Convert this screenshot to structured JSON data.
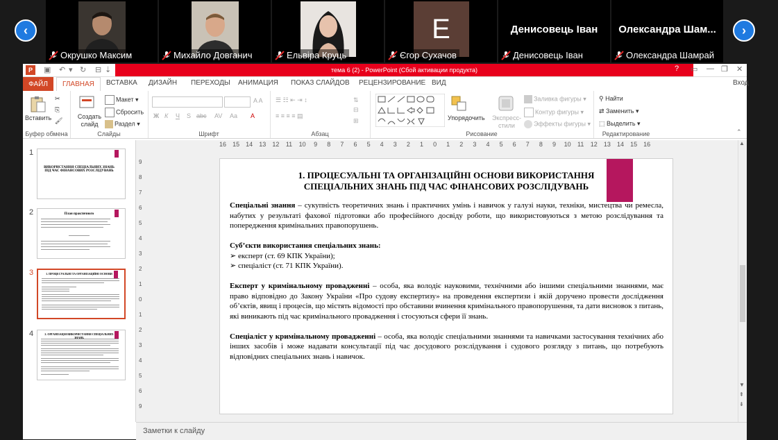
{
  "zoom": {
    "participants": [
      {
        "name": "Окрушко Максим",
        "avatar": "photo"
      },
      {
        "name": "Михайло Довганич",
        "avatar": "photo"
      },
      {
        "name": "Ельвіра Круць",
        "avatar": "photo"
      },
      {
        "name": "Єгор Сухачов",
        "avatar": "letter",
        "letter": "E"
      },
      {
        "name": "Денисовець Іван",
        "display": "Денисовець Іван"
      },
      {
        "name": "Олександра Шамрай",
        "display": "Олександра  Шам..."
      }
    ],
    "more_label": "•••",
    "prev_arrow": "‹",
    "next_arrow": "›"
  },
  "window": {
    "title": "тема 6 (2) -  PowerPoint (Сбой активации продукта)",
    "app_icon": "P",
    "login": "Вход"
  },
  "tabs": [
    "ФАЙЛ",
    "ГЛАВНАЯ",
    "ВСТАВКА",
    "ДИЗАЙН",
    "ПЕРЕХОДЫ",
    "АНИМАЦИЯ",
    "ПОКАЗ СЛАЙДОВ",
    "РЕЦЕНЗИРОВАНИЕ",
    "ВИД"
  ],
  "ribbon": {
    "clipboard": {
      "paste": "Вставить",
      "label": "Буфер обмена"
    },
    "slides": {
      "new_slide": "Создать слайд",
      "layout": "Макет",
      "reset": "Сбросить",
      "section": "Раздел",
      "label": "Слайды"
    },
    "font": {
      "label": "Шрифт",
      "bold": "Ж",
      "italic": "К",
      "underline": "Ч",
      "strike": "S",
      "shadow": "abc",
      "aa": "Aa"
    },
    "paragraph": {
      "label": "Абзац"
    },
    "drawing": {
      "arrange": "Упорядочить",
      "quick_styles": "Экспресс-стили",
      "fill": "Заливка фигуры",
      "outline": "Контур фигуры",
      "effects": "Эффекты фигуры",
      "label": "Рисование"
    },
    "editing": {
      "find": "Найти",
      "replace": "Заменить",
      "select": "Выделить",
      "label": "Редактирование"
    }
  },
  "thumbnails": [
    {
      "num": "1",
      "title": "ВИКОРИСТАННЯ СПЕЦІАЛЬНИХ ЗНАНЬ ПІД ЧАС ФІНАНСОВИХ РОЗСЛІДУВАНЬ"
    },
    {
      "num": "2",
      "title": "План практичного"
    },
    {
      "num": "3",
      "title": "1. ПРОЦЕСУАЛЬНІ ТА ОРГАНІЗАЦІЙНІ ОСНОВИ"
    },
    {
      "num": "4",
      "title": "2. ОРГАНІЗАЦІЯ ВИКОРИСТАННЯ СПЕЦІАЛЬНИХ ЗНАНЬ"
    }
  ],
  "ruler": [
    "16",
    "15",
    "14",
    "13",
    "12",
    "11",
    "10",
    "9",
    "8",
    "7",
    "6",
    "5",
    "4",
    "3",
    "2",
    "1",
    "0",
    "1",
    "2",
    "3",
    "4",
    "5",
    "6",
    "7",
    "8",
    "9",
    "10",
    "11",
    "12",
    "13",
    "14",
    "15",
    "16"
  ],
  "slide": {
    "title_line1": "1. ПРОЦЕСУАЛЬНІ ТА ОРГАНІЗАЦІЙНІ ОСНОВИ ВИКОРИСТАННЯ",
    "title_line2": "СПЕЦІАЛЬНИХ ЗНАНЬ ПІД ЧАС ФІНАНСОВИХ РОЗСЛІДУВАНЬ",
    "p1_bold": "Спеціальні знання",
    "p1_text": " – сукупність теоретичних знань і практичних умінь і навичок у галузі науки, техніки, мистецтва чи ремесла, набутих у результаті фахової підготовки або професійного досвіду роботи, що використовуються з метою розслідування та попередження кримінальних правопорушень.",
    "p2_bold": "Суб’єкти використання спеціальних знань:",
    "bullet1": "експерт (ст. 69 КПК України);",
    "bullet2": "спеціаліст (ст. 71 КПК України).",
    "p3_bold": "Експерт у кримінальному провадженні",
    "p3_text": " – особа, яка володіє науковими, технічними або іншими спеціальними знаннями, має право відповідно до Закону України «Про судову експертизу» на проведення експертизи і якій доручено провести дослідження об’єктів, явищ і процесів, що містять відомості про обставини вчинення кримінального правопорушення, та дати висновок з питань, які виникають під час кримінального провадження і стосуються сфери її знань.",
    "p4_bold": "Спеціаліст у кримінальному провадженні",
    "p4_text": " – особа, яка володіє спеціальними знаннями та навичками застосування технічних або інших засобів і може надавати консультації під час досудового розслідування і судового розгляду з питань, що потребують відповідних спеціальних знань і навичок."
  },
  "notes_placeholder": "Заметки к слайду"
}
